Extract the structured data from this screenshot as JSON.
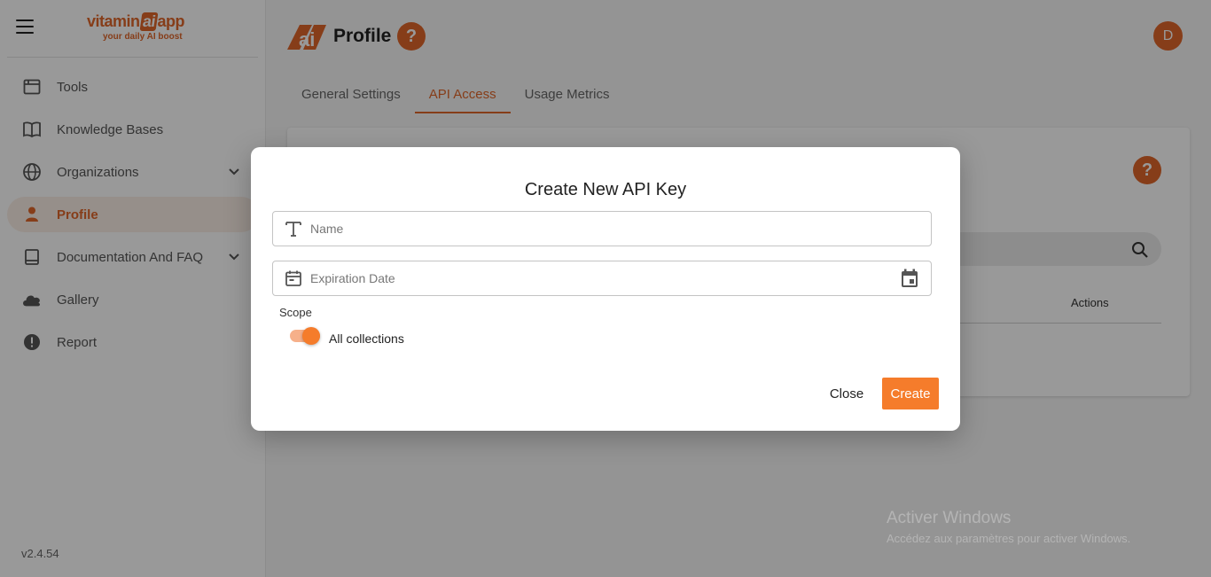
{
  "sidebar": {
    "brand": {
      "pre": "vitamin",
      "ai": "ai",
      "post": "app",
      "tagline": "your daily AI boost"
    },
    "items": [
      {
        "label": "Tools",
        "icon": "browser-window-icon"
      },
      {
        "label": "Knowledge Bases",
        "icon": "open-book-icon"
      },
      {
        "label": "Organizations",
        "icon": "globe-icon"
      },
      {
        "label": "Profile",
        "icon": "person-icon"
      },
      {
        "label": "Documentation And FAQ",
        "icon": "book-icon"
      },
      {
        "label": "Gallery",
        "icon": "cloud-icon"
      },
      {
        "label": "Report",
        "icon": "alert-circle-icon"
      }
    ],
    "version": "v2.4.54"
  },
  "header": {
    "logo_text": "ai",
    "title": "Profile",
    "help": "?",
    "avatar": "D"
  },
  "tabs": [
    {
      "label": "General Settings",
      "active": false
    },
    {
      "label": "API Access",
      "active": true
    },
    {
      "label": "Usage Metrics",
      "active": false
    }
  ],
  "card": {
    "help": "?",
    "actions_header": "Actions"
  },
  "modal": {
    "title": "Create New API Key",
    "name_placeholder": "Name",
    "date_placeholder": "Expiration Date",
    "scope_label": "Scope",
    "toggle_label": "All collections",
    "toggle_on": true,
    "close_label": "Close",
    "create_label": "Create"
  },
  "watermark": {
    "line1": "Activer Windows",
    "line2": "Accédez aux paramètres pour activer Windows."
  },
  "colors": {
    "accent": "#e0662a",
    "button": "#f57c2b"
  }
}
